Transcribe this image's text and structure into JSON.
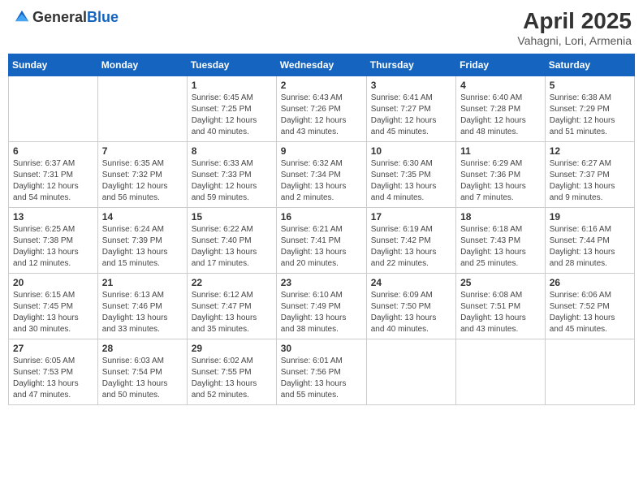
{
  "header": {
    "logo_general": "General",
    "logo_blue": "Blue",
    "title": "April 2025",
    "location": "Vahagni, Lori, Armenia"
  },
  "days_of_week": [
    "Sunday",
    "Monday",
    "Tuesday",
    "Wednesday",
    "Thursday",
    "Friday",
    "Saturday"
  ],
  "weeks": [
    [
      {
        "day": "",
        "info": ""
      },
      {
        "day": "",
        "info": ""
      },
      {
        "day": "1",
        "info": "Sunrise: 6:45 AM\nSunset: 7:25 PM\nDaylight: 12 hours and 40 minutes."
      },
      {
        "day": "2",
        "info": "Sunrise: 6:43 AM\nSunset: 7:26 PM\nDaylight: 12 hours and 43 minutes."
      },
      {
        "day": "3",
        "info": "Sunrise: 6:41 AM\nSunset: 7:27 PM\nDaylight: 12 hours and 45 minutes."
      },
      {
        "day": "4",
        "info": "Sunrise: 6:40 AM\nSunset: 7:28 PM\nDaylight: 12 hours and 48 minutes."
      },
      {
        "day": "5",
        "info": "Sunrise: 6:38 AM\nSunset: 7:29 PM\nDaylight: 12 hours and 51 minutes."
      }
    ],
    [
      {
        "day": "6",
        "info": "Sunrise: 6:37 AM\nSunset: 7:31 PM\nDaylight: 12 hours and 54 minutes."
      },
      {
        "day": "7",
        "info": "Sunrise: 6:35 AM\nSunset: 7:32 PM\nDaylight: 12 hours and 56 minutes."
      },
      {
        "day": "8",
        "info": "Sunrise: 6:33 AM\nSunset: 7:33 PM\nDaylight: 12 hours and 59 minutes."
      },
      {
        "day": "9",
        "info": "Sunrise: 6:32 AM\nSunset: 7:34 PM\nDaylight: 13 hours and 2 minutes."
      },
      {
        "day": "10",
        "info": "Sunrise: 6:30 AM\nSunset: 7:35 PM\nDaylight: 13 hours and 4 minutes."
      },
      {
        "day": "11",
        "info": "Sunrise: 6:29 AM\nSunset: 7:36 PM\nDaylight: 13 hours and 7 minutes."
      },
      {
        "day": "12",
        "info": "Sunrise: 6:27 AM\nSunset: 7:37 PM\nDaylight: 13 hours and 9 minutes."
      }
    ],
    [
      {
        "day": "13",
        "info": "Sunrise: 6:25 AM\nSunset: 7:38 PM\nDaylight: 13 hours and 12 minutes."
      },
      {
        "day": "14",
        "info": "Sunrise: 6:24 AM\nSunset: 7:39 PM\nDaylight: 13 hours and 15 minutes."
      },
      {
        "day": "15",
        "info": "Sunrise: 6:22 AM\nSunset: 7:40 PM\nDaylight: 13 hours and 17 minutes."
      },
      {
        "day": "16",
        "info": "Sunrise: 6:21 AM\nSunset: 7:41 PM\nDaylight: 13 hours and 20 minutes."
      },
      {
        "day": "17",
        "info": "Sunrise: 6:19 AM\nSunset: 7:42 PM\nDaylight: 13 hours and 22 minutes."
      },
      {
        "day": "18",
        "info": "Sunrise: 6:18 AM\nSunset: 7:43 PM\nDaylight: 13 hours and 25 minutes."
      },
      {
        "day": "19",
        "info": "Sunrise: 6:16 AM\nSunset: 7:44 PM\nDaylight: 13 hours and 28 minutes."
      }
    ],
    [
      {
        "day": "20",
        "info": "Sunrise: 6:15 AM\nSunset: 7:45 PM\nDaylight: 13 hours and 30 minutes."
      },
      {
        "day": "21",
        "info": "Sunrise: 6:13 AM\nSunset: 7:46 PM\nDaylight: 13 hours and 33 minutes."
      },
      {
        "day": "22",
        "info": "Sunrise: 6:12 AM\nSunset: 7:47 PM\nDaylight: 13 hours and 35 minutes."
      },
      {
        "day": "23",
        "info": "Sunrise: 6:10 AM\nSunset: 7:49 PM\nDaylight: 13 hours and 38 minutes."
      },
      {
        "day": "24",
        "info": "Sunrise: 6:09 AM\nSunset: 7:50 PM\nDaylight: 13 hours and 40 minutes."
      },
      {
        "day": "25",
        "info": "Sunrise: 6:08 AM\nSunset: 7:51 PM\nDaylight: 13 hours and 43 minutes."
      },
      {
        "day": "26",
        "info": "Sunrise: 6:06 AM\nSunset: 7:52 PM\nDaylight: 13 hours and 45 minutes."
      }
    ],
    [
      {
        "day": "27",
        "info": "Sunrise: 6:05 AM\nSunset: 7:53 PM\nDaylight: 13 hours and 47 minutes."
      },
      {
        "day": "28",
        "info": "Sunrise: 6:03 AM\nSunset: 7:54 PM\nDaylight: 13 hours and 50 minutes."
      },
      {
        "day": "29",
        "info": "Sunrise: 6:02 AM\nSunset: 7:55 PM\nDaylight: 13 hours and 52 minutes."
      },
      {
        "day": "30",
        "info": "Sunrise: 6:01 AM\nSunset: 7:56 PM\nDaylight: 13 hours and 55 minutes."
      },
      {
        "day": "",
        "info": ""
      },
      {
        "day": "",
        "info": ""
      },
      {
        "day": "",
        "info": ""
      }
    ]
  ]
}
